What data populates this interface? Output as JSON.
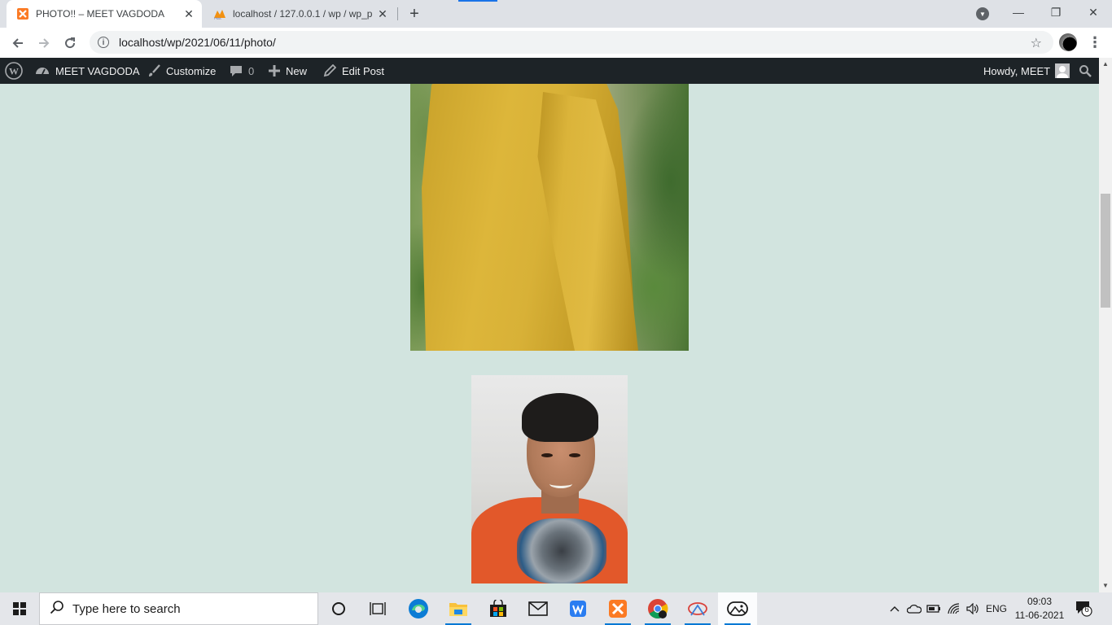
{
  "browser": {
    "tabs": [
      {
        "title": "PHOTO!! – MEET VAGDODA",
        "icon": "xampp-icon",
        "active": true
      },
      {
        "title": "localhost / 127.0.0.1 / wp / wp_p",
        "icon": "phpmyadmin-icon",
        "active": false
      }
    ],
    "url": "localhost/wp/2021/06/11/photo/",
    "accent_color": "#1a73e8"
  },
  "admin_bar": {
    "site_name": "MEET VAGDODA",
    "customize": "Customize",
    "comments_count": "0",
    "new_label": "New",
    "edit_label": "Edit Post",
    "howdy": "Howdy, MEET",
    "background_color": "#1d2327"
  },
  "page": {
    "background_color": "#d2e4df",
    "images": [
      {
        "description_icon": "photo-yellow-shirt"
      },
      {
        "description_icon": "photo-selfie"
      }
    ]
  },
  "taskbar": {
    "search_placeholder": "Type here to search",
    "apps": [
      "cortana-icon",
      "task-view-icon",
      "edge-icon",
      "file-explorer-icon",
      "store-icon",
      "mail-icon",
      "wps-office-icon",
      "xampp-icon",
      "chrome-icon",
      "snipping-icon",
      "photos-icon"
    ],
    "language": "ENG",
    "time": "09:03",
    "date": "11-06-2021",
    "notification_count": "6"
  }
}
